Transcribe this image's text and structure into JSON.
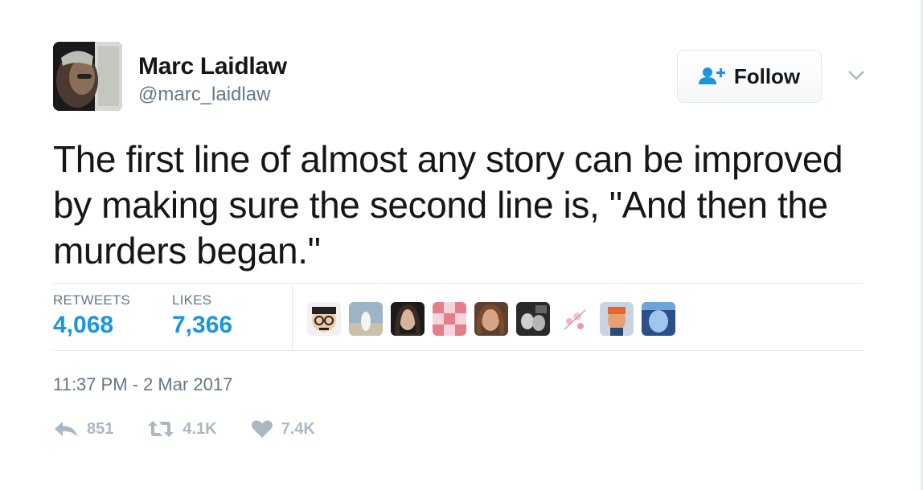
{
  "author": {
    "name": "Marc Laidlaw",
    "handle": "@marc_laidlaw"
  },
  "follow_button": {
    "label": "Follow",
    "icon": "add-person-icon"
  },
  "menu_icon": "chevron-down-icon",
  "tweet_text": "The first line of almost any story can be improved by making sure the second line is, \"And then the murders began.\"",
  "stats": {
    "retweets_label": "RETWEETS",
    "retweets_value": "4,068",
    "likes_label": "LIKES",
    "likes_value": "7,366"
  },
  "likers_count_shown": 9,
  "timestamp": "11:37 PM - 2 Mar 2017",
  "actions": {
    "reply_count": "851",
    "retweet_count": "4.1K",
    "like_count": "7.4K"
  },
  "colors": {
    "accent": "#1b95e0",
    "muted": "#657786",
    "action_gray": "#aab8c2",
    "border": "#e1e8ed"
  }
}
